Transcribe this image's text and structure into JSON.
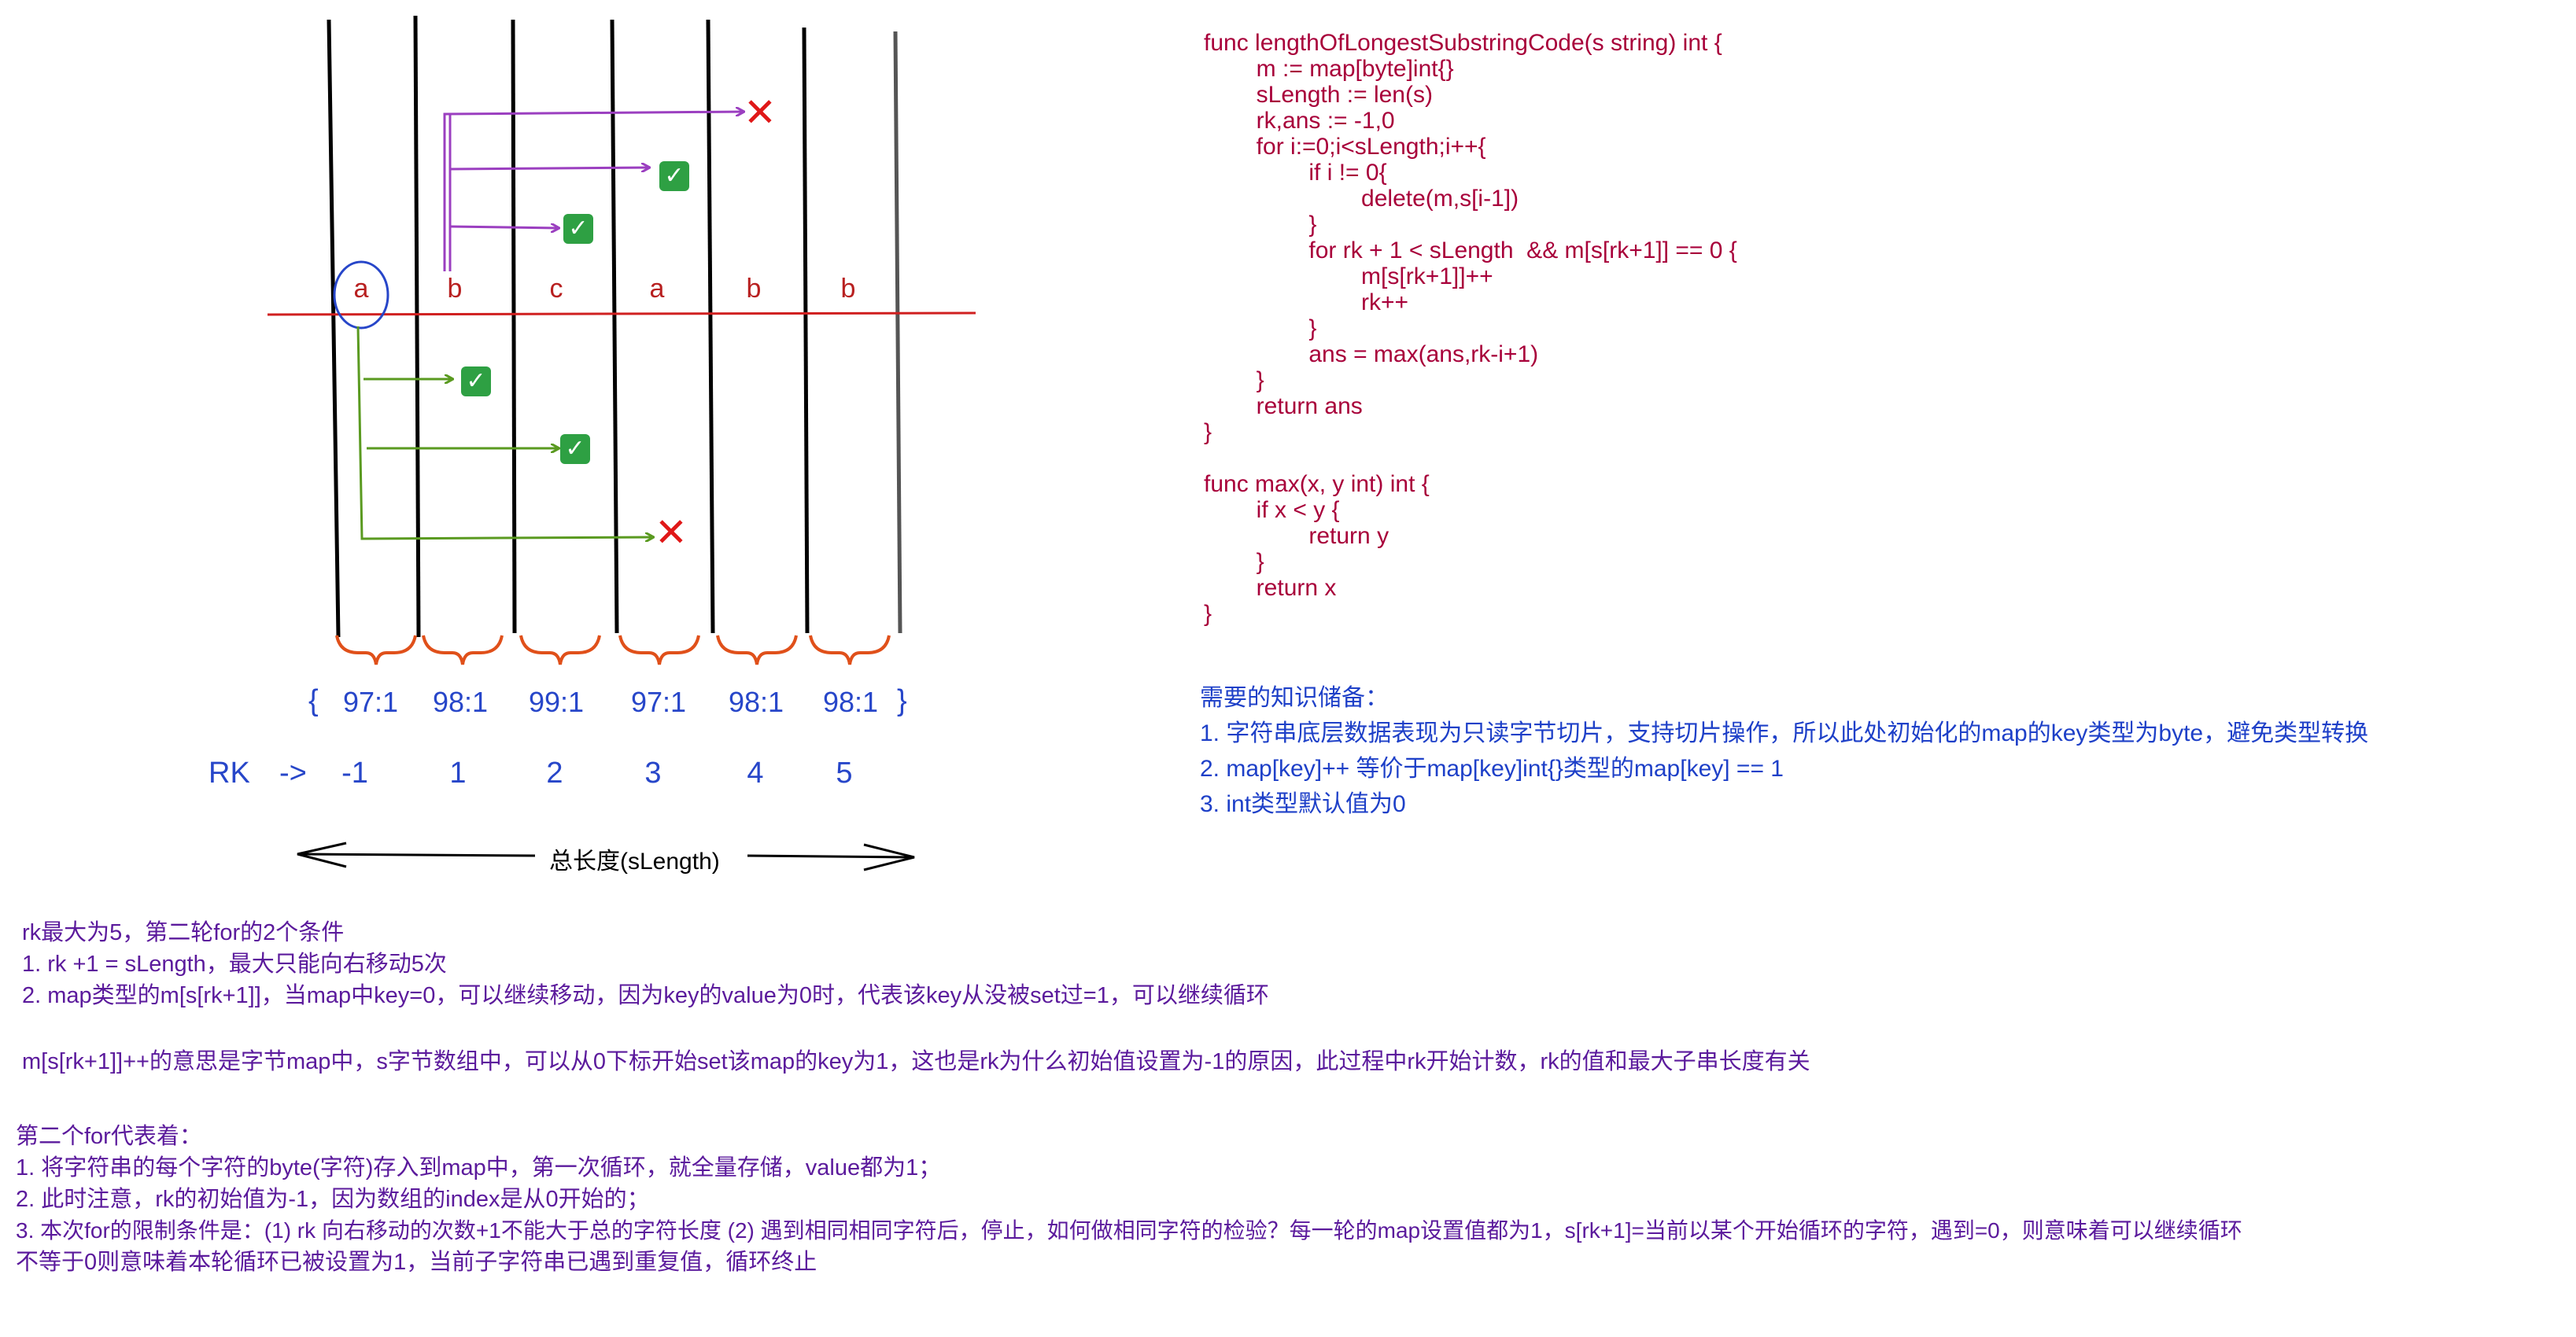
{
  "cells": [
    "a",
    "b",
    "c",
    "a",
    "b",
    "b"
  ],
  "map_open": "{",
  "map_close": "}",
  "map_values": [
    "97:1",
    "98:1",
    "99:1",
    "97:1",
    "98:1",
    "98:1"
  ],
  "rk_label": "RK",
  "rk_arrow": "->",
  "rk_values": [
    "-1",
    "1",
    "2",
    "3",
    "4",
    "5"
  ],
  "length_label": "总长度(sLength)",
  "code_lines": [
    "func lengthOfLongestSubstringCode(s string) int {",
    "        m := map[byte]int{}",
    "        sLength := len(s)",
    "        rk,ans := -1,0",
    "        for i:=0;i<sLength;i++{",
    "                if i != 0{",
    "                        delete(m,s[i-1])",
    "                }",
    "                for rk + 1 < sLength  && m[s[rk+1]] == 0 {",
    "                        m[s[rk+1]]++",
    "                        rk++",
    "                }",
    "                ans = max(ans,rk-i+1)",
    "        }",
    "        return ans",
    "}",
    "",
    "func max(x, y int) int {",
    "        if x < y {",
    "                return y",
    "        }",
    "        return x",
    "}"
  ],
  "knowledge_notes": [
    "需要的知识储备：",
    "1. 字符串底层数据表现为只读字节切片，支持切片操作，所以此处初始化的map的key类型为byte，避免类型转换",
    "2. map[key]++ 等价于map[key]int{}类型的map[key] == 1",
    "3. int类型默认值为0"
  ],
  "rk_notes": [
    "rk最大为5，第二轮for的2个条件",
    "1. rk +1 = sLength，最大只能向右移动5次",
    "2. map类型的m[s[rk+1]]，当map中key=0，可以继续移动，因为key的value为0时，代表该key从没被set过=1，可以继续循环"
  ],
  "m_note": "m[s[rk+1]]++的意思是字节map中，s字节数组中，可以从0下标开始set该map的key为1，这也是rk为什么初始值设置为-1的原因，此过程中rk开始计数，rk的值和最大子串长度有关",
  "second_for_notes": [
    "第二个for代表着：",
    "1. 将字符串的每个字符的byte(字符)存入到map中，第一次循环，就全量存储，value都为1；",
    "2. 此时注意，rk的初始值为-1，因为数组的index是从0开始的；",
    "3. 本次for的限制条件是：(1) rk 向右移动的次数+1不能大于总的字符长度 (2) 遇到相同相同字符后，停止，如何做相同字符的检验？每一轮的map设置值都为1，s[rk+1]=当前以某个开始循环的字符，遇到=0，则意味着可以继续循环",
    "不等于0则意味着本轮循环已被设置为1，当前子字符串已遇到重复值，循环终止"
  ],
  "icons": {
    "check": "check-mark-icon",
    "cross": "cross-mark-icon"
  },
  "colors": {
    "purple_arrows": "#9b3fc0",
    "green_arrows": "#5a9a20",
    "red_line": "#d02020",
    "code_text": "#a8003a",
    "blue_text": "#1e40c8",
    "purple_text": "#5b1a9c",
    "brace_orange": "#e0501a"
  }
}
